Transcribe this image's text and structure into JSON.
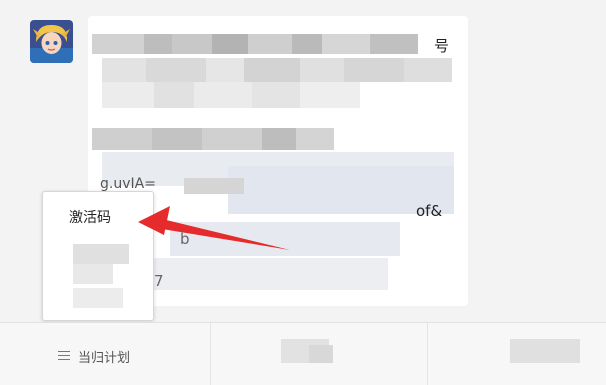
{
  "message": {
    "tail_top": "号",
    "tail_mid": "of&",
    "fragment_left": "g.uvIA=",
    "fragment_b": "b",
    "fragment_7": "7"
  },
  "context_menu": {
    "items": [
      {
        "label": "激活码",
        "icon": "none"
      }
    ]
  },
  "bottom_menu": {
    "items": [
      {
        "label": "当归计划",
        "icon": "hamburger-icon"
      }
    ]
  },
  "annotation": {
    "arrow_color": "#e52b2b"
  }
}
